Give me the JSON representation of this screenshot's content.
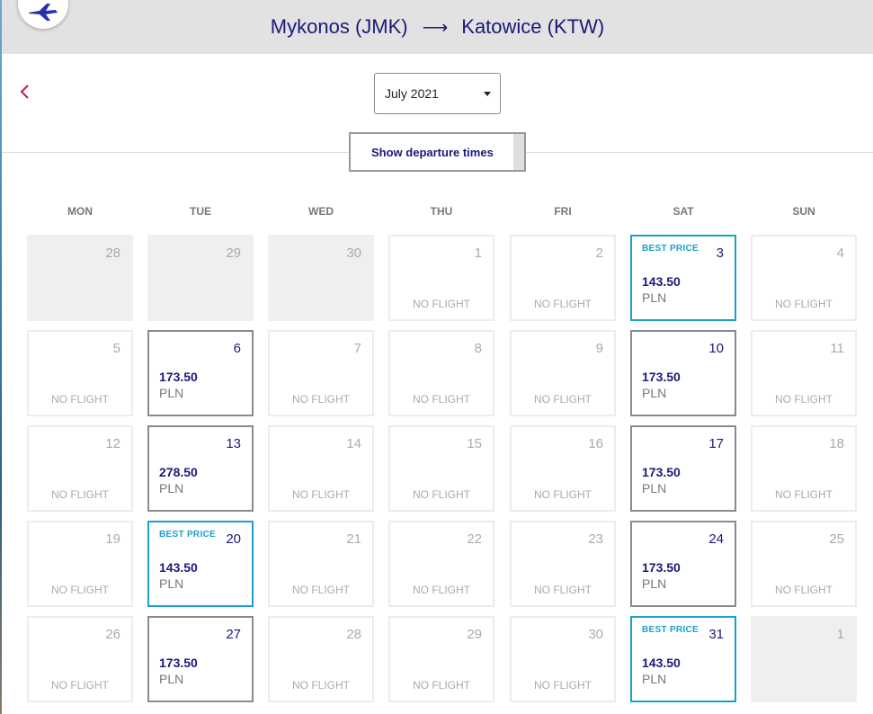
{
  "header": {
    "origin": "Mykonos (JMK)",
    "arrow": "⟶",
    "destination": "Katowice (KTW)"
  },
  "nav": {
    "back_icon": "chevron-left-icon"
  },
  "month_select": {
    "value": "July 2021"
  },
  "departure_button": {
    "label": "Show departure times"
  },
  "colors": {
    "brand": "#1a1a7a",
    "best_price": "#19a1cc",
    "back": "#c2185b"
  },
  "weekdays": [
    "MON",
    "TUE",
    "WED",
    "THU",
    "FRI",
    "SAT",
    "SUN"
  ],
  "calendar": [
    [
      {
        "day": "28",
        "status": "other"
      },
      {
        "day": "29",
        "status": "other"
      },
      {
        "day": "30",
        "status": "other"
      },
      {
        "day": "1",
        "status": "none",
        "note": "NO FLIGHT"
      },
      {
        "day": "2",
        "status": "none",
        "note": "NO FLIGHT"
      },
      {
        "day": "3",
        "status": "best",
        "badge": "BEST PRICE",
        "price": "143.50",
        "currency": "PLN"
      },
      {
        "day": "4",
        "status": "none",
        "note": "NO FLIGHT"
      }
    ],
    [
      {
        "day": "5",
        "status": "none",
        "note": "NO FLIGHT"
      },
      {
        "day": "6",
        "status": "flight",
        "price": "173.50",
        "currency": "PLN"
      },
      {
        "day": "7",
        "status": "none",
        "note": "NO FLIGHT"
      },
      {
        "day": "8",
        "status": "none",
        "note": "NO FLIGHT"
      },
      {
        "day": "9",
        "status": "none",
        "note": "NO FLIGHT"
      },
      {
        "day": "10",
        "status": "flight",
        "price": "173.50",
        "currency": "PLN"
      },
      {
        "day": "11",
        "status": "none",
        "note": "NO FLIGHT"
      }
    ],
    [
      {
        "day": "12",
        "status": "none",
        "note": "NO FLIGHT"
      },
      {
        "day": "13",
        "status": "flight",
        "price": "278.50",
        "currency": "PLN"
      },
      {
        "day": "14",
        "status": "none",
        "note": "NO FLIGHT"
      },
      {
        "day": "15",
        "status": "none",
        "note": "NO FLIGHT"
      },
      {
        "day": "16",
        "status": "none",
        "note": "NO FLIGHT"
      },
      {
        "day": "17",
        "status": "flight",
        "price": "173.50",
        "currency": "PLN"
      },
      {
        "day": "18",
        "status": "none",
        "note": "NO FLIGHT"
      }
    ],
    [
      {
        "day": "19",
        "status": "none",
        "note": "NO FLIGHT"
      },
      {
        "day": "20",
        "status": "best",
        "badge": "BEST PRICE",
        "price": "143.50",
        "currency": "PLN"
      },
      {
        "day": "21",
        "status": "none",
        "note": "NO FLIGHT"
      },
      {
        "day": "22",
        "status": "none",
        "note": "NO FLIGHT"
      },
      {
        "day": "23",
        "status": "none",
        "note": "NO FLIGHT"
      },
      {
        "day": "24",
        "status": "flight",
        "price": "173.50",
        "currency": "PLN"
      },
      {
        "day": "25",
        "status": "none",
        "note": "NO FLIGHT"
      }
    ],
    [
      {
        "day": "26",
        "status": "none",
        "note": "NO FLIGHT"
      },
      {
        "day": "27",
        "status": "flight",
        "price": "173.50",
        "currency": "PLN"
      },
      {
        "day": "28",
        "status": "none",
        "note": "NO FLIGHT"
      },
      {
        "day": "29",
        "status": "none",
        "note": "NO FLIGHT"
      },
      {
        "day": "30",
        "status": "none",
        "note": "NO FLIGHT"
      },
      {
        "day": "31",
        "status": "best",
        "badge": "BEST PRICE",
        "price": "143.50",
        "currency": "PLN"
      },
      {
        "day": "1",
        "status": "other"
      }
    ]
  ]
}
